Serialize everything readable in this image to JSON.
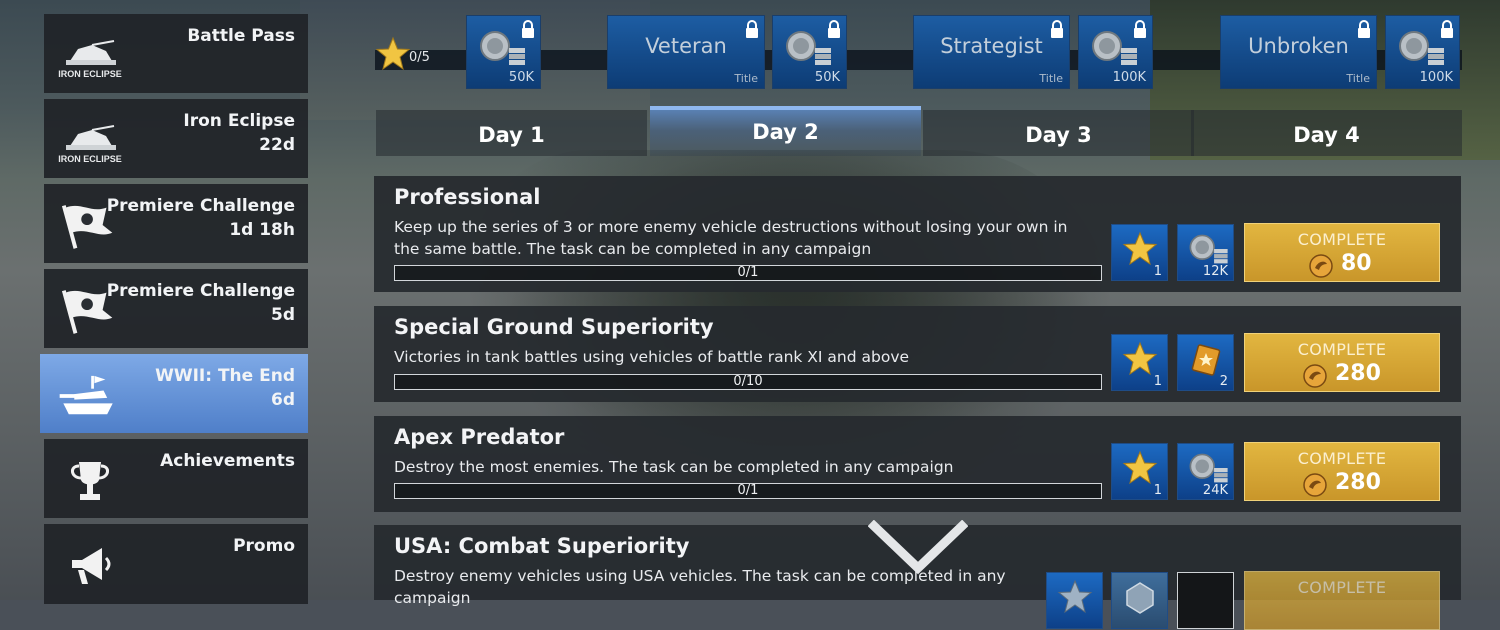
{
  "sidebar": {
    "items": [
      {
        "label": "Battle Pass",
        "sub": "",
        "icon": "iron-eclipse-logo",
        "logo_text": "IRON ECLIPSE"
      },
      {
        "label": "Iron Eclipse",
        "sub": "22d",
        "icon": "iron-eclipse-logo",
        "logo_text": "IRON ECLIPSE"
      },
      {
        "label": "Premiere Challenge",
        "sub": "1d 18h",
        "icon": "flag-icon"
      },
      {
        "label": "Premiere Challenge",
        "sub": "5d",
        "icon": "flag-icon"
      },
      {
        "label": "WWII: The End",
        "sub": "6d",
        "icon": "tank-icon",
        "active": true
      },
      {
        "label": "Achievements",
        "sub": "",
        "icon": "trophy-icon"
      },
      {
        "label": "Promo",
        "sub": "",
        "icon": "megaphone-icon"
      }
    ]
  },
  "reward_track": {
    "stars": "0/5",
    "rewards": [
      {
        "type": "silver",
        "amount": "50K",
        "locked": true
      },
      {
        "type": "title",
        "name": "Veteran",
        "tag": "Title",
        "locked": true
      },
      {
        "type": "silver",
        "amount": "50K",
        "locked": true
      },
      {
        "type": "title",
        "name": "Strategist",
        "tag": "Title",
        "locked": true
      },
      {
        "type": "silver",
        "amount": "100K",
        "locked": true
      },
      {
        "type": "title",
        "name": "Unbroken",
        "tag": "Title",
        "locked": true
      },
      {
        "type": "silver",
        "amount": "100K",
        "locked": true
      }
    ]
  },
  "day_tabs": [
    {
      "label": "Day 1"
    },
    {
      "label": "Day 2",
      "active": true
    },
    {
      "label": "Day 3"
    },
    {
      "label": "Day 4"
    }
  ],
  "tasks": [
    {
      "title": "Professional",
      "description": "Keep up the series of 3 or more enemy vehicle destructions without losing your own in the same battle. The task can be completed in any campaign",
      "progress": "0/1",
      "rewards": [
        {
          "icon": "star-icon",
          "count": "1"
        },
        {
          "icon": "silver-coins-icon",
          "count": "12K"
        }
      ],
      "complete_label": "COMPLETE",
      "cost": "80"
    },
    {
      "title": "Special Ground Superiority",
      "description": "Victories in tank battles using vehicles of battle rank XI and above",
      "progress": "0/10",
      "rewards": [
        {
          "icon": "star-icon",
          "count": "1"
        },
        {
          "icon": "booster-icon",
          "count": "2"
        }
      ],
      "complete_label": "COMPLETE",
      "cost": "280"
    },
    {
      "title": "Apex Predator",
      "description": "Destroy the most enemies. The task can be completed in any campaign",
      "progress": "0/1",
      "rewards": [
        {
          "icon": "star-icon",
          "count": "1"
        },
        {
          "icon": "silver-coins-icon",
          "count": "24K"
        }
      ],
      "complete_label": "COMPLETE",
      "cost": "280"
    },
    {
      "title": "USA: Combat Superiority",
      "description": "Destroy enemy vehicles using USA vehicles. The task can be completed in any campaign",
      "complete_label": "COMPLETE"
    }
  ],
  "colors": {
    "accent": "#4f7fc9",
    "reward_blue": "#1d5da3",
    "complete_gold": "#d8aa36"
  }
}
